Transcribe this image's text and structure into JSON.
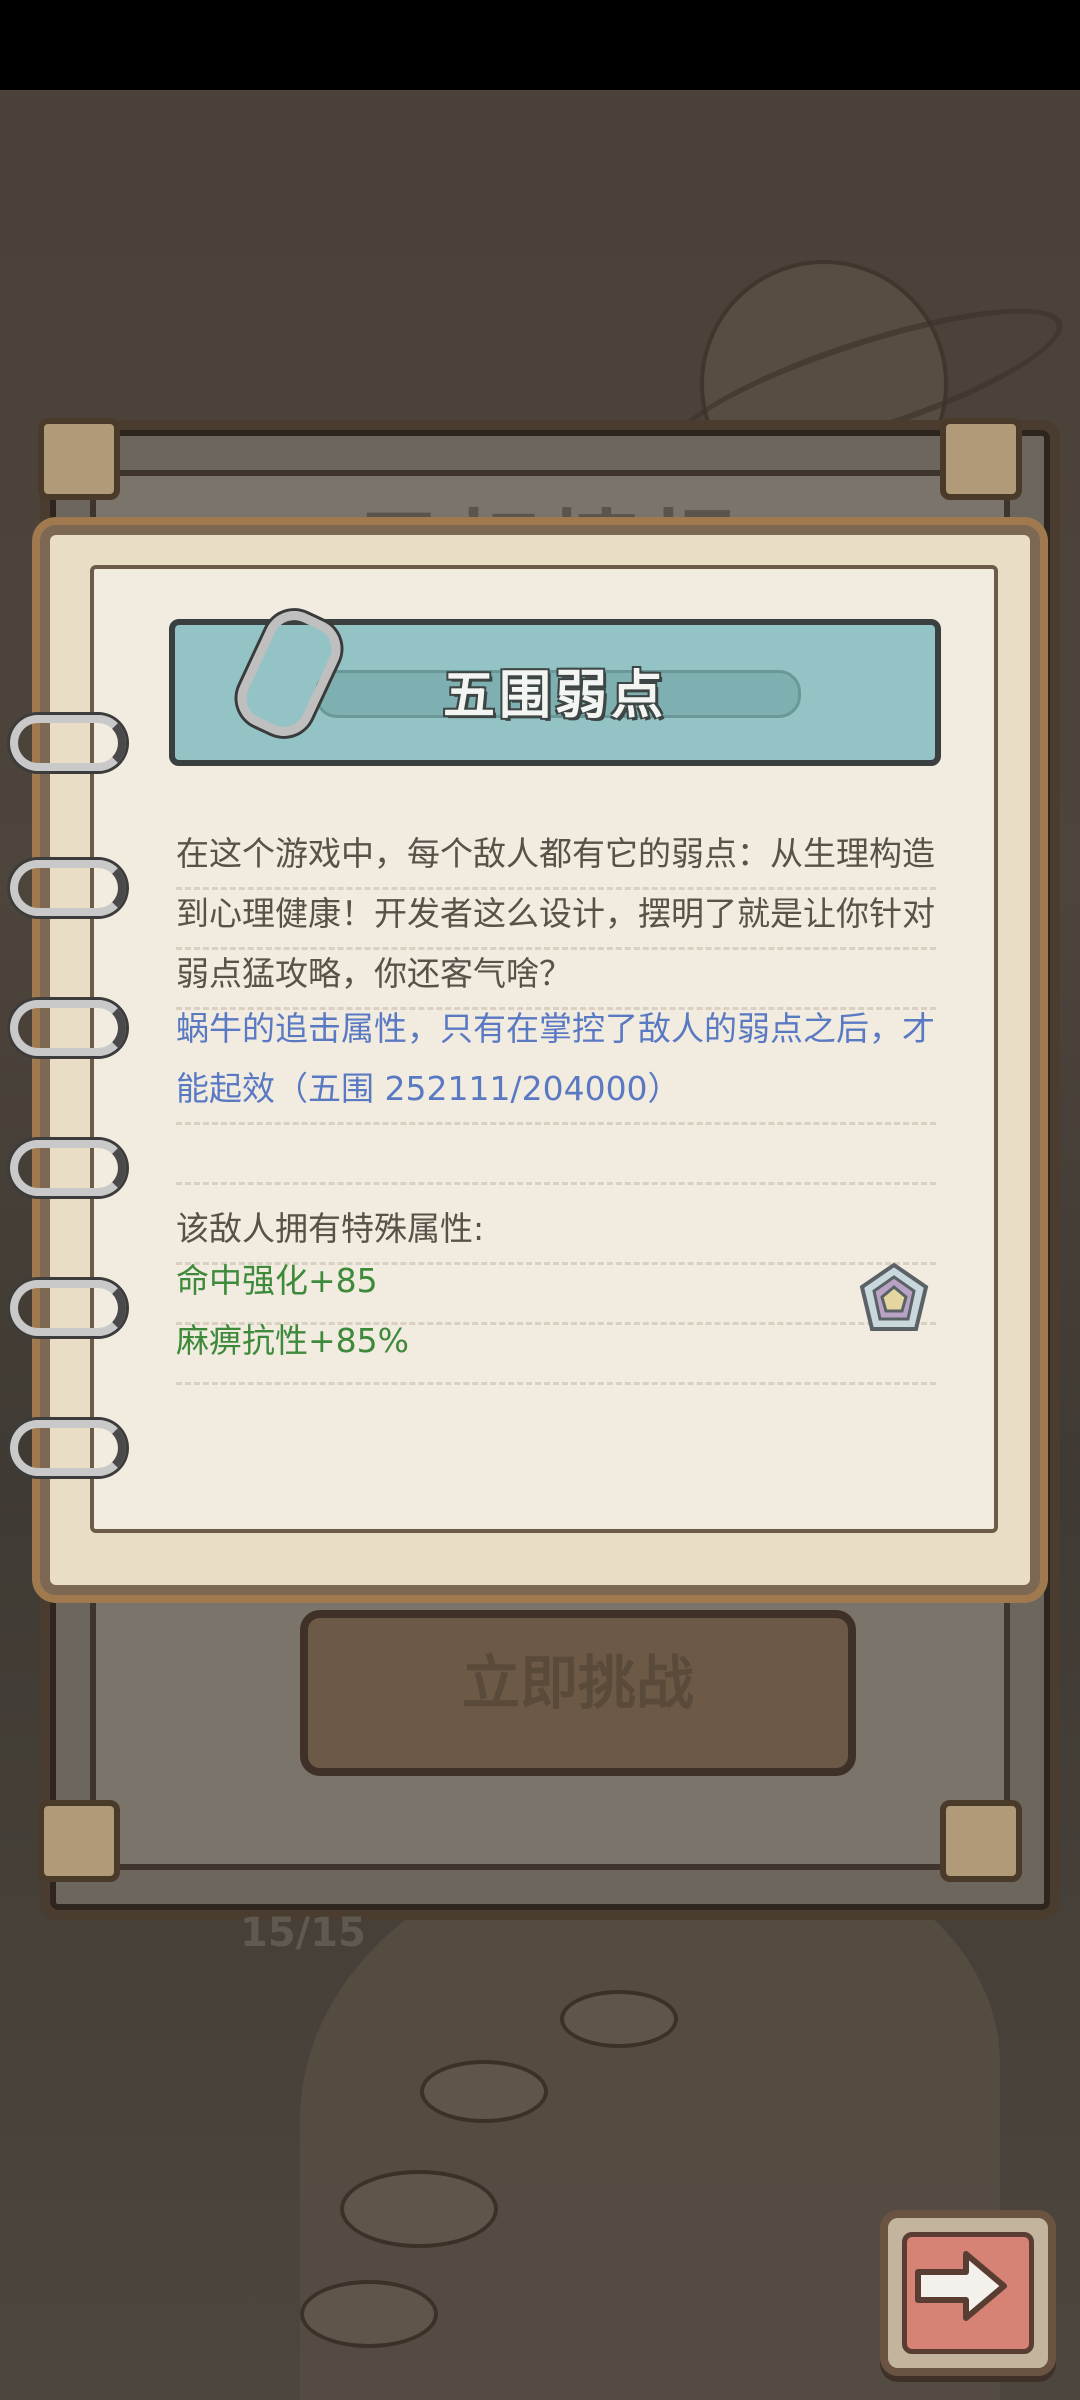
{
  "background": {
    "back_card_title": "目标情报",
    "challenge_button": "立即挑战",
    "counter": "15/15"
  },
  "card": {
    "title": "五围弱点",
    "intro": "在这个游戏中，每个敌人都有它的弱点：从生理构造到心理健康！开发者这么设计，摆明了就是让你针对弱点猛攻略，你还客气啥？",
    "snail_note": "蜗牛的追击属性，只有在掌控了敌人的弱点之后，才能起效（五围  252111/204000）",
    "attributes_title": "该敌人拥有特殊属性:",
    "attributes": [
      "命中强化+85",
      "麻痹抗性+85%"
    ]
  },
  "icons": {
    "next": "arrow-right-icon",
    "attribute": "crystal-icon",
    "clip": "paperclip-icon"
  },
  "colors": {
    "banner": "#93c3c4",
    "blue_text": "#5a79c3",
    "green_text": "#3e8a3b"
  }
}
